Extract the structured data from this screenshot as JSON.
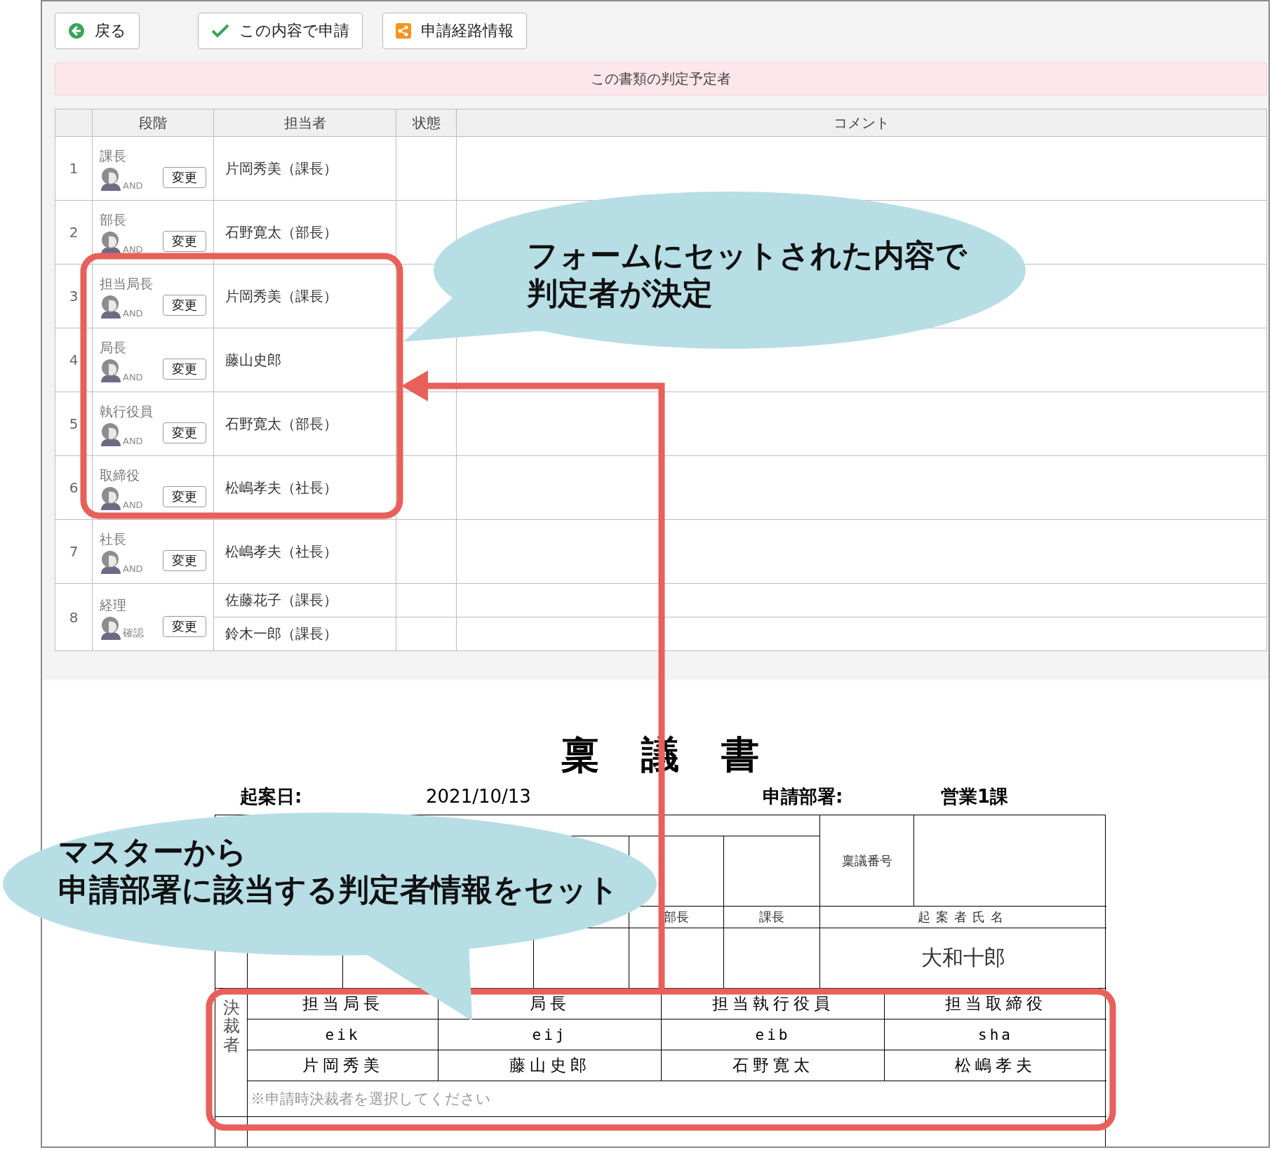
{
  "toolbar": {
    "buttons": [
      {
        "kind": "back",
        "label": "戻る"
      },
      {
        "kind": "check",
        "label": "この内容で申請"
      },
      {
        "kind": "route",
        "label": "申請経路情報"
      }
    ]
  },
  "banner": "この書類の判定予定者",
  "approvers": {
    "columns": [
      "段階",
      "担当者",
      "状態",
      "コメント"
    ],
    "rows": [
      {
        "number": "1",
        "stage": "課長",
        "mode": "AND",
        "action": "変更",
        "assignees": [
          "片岡秀美（課長）"
        ]
      },
      {
        "number": "2",
        "stage": "部長",
        "mode": "AND",
        "action": "変更",
        "assignees": [
          "石野寛太（部長）"
        ]
      },
      {
        "number": "3",
        "stage": "担当局長",
        "mode": "AND",
        "action": "変更",
        "assignees": [
          "片岡秀美（課長）"
        ]
      },
      {
        "number": "4",
        "stage": "局長",
        "mode": "AND",
        "action": "変更",
        "assignees": [
          "藤山史郎"
        ]
      },
      {
        "number": "5",
        "stage": "執行役員",
        "mode": "AND",
        "action": "変更",
        "assignees": [
          "石野寛太（部長）"
        ]
      },
      {
        "number": "6",
        "stage": "取締役",
        "mode": "AND",
        "action": "変更",
        "assignees": [
          "松嶋孝夫（社長）"
        ]
      },
      {
        "number": "7",
        "stage": "社長",
        "mode": "AND",
        "action": "変更",
        "assignees": [
          "松嶋孝夫（社長）"
        ]
      },
      {
        "number": "8",
        "stage": "経理",
        "mode": "確認",
        "action": "変更",
        "assignees": [
          "佐藤花子（課長）",
          "鈴木一郎（課長）"
        ]
      }
    ]
  },
  "document": {
    "title": "稟議書",
    "fields": [
      {
        "label": "起案日:",
        "value": "2021/10/13"
      },
      {
        "label": "申請部署:",
        "value": "営業1課"
      }
    ],
    "stamp_headers": [
      "部長",
      "課長"
    ],
    "number_label": "稟議番号",
    "drafter_label": "起案者氏名",
    "drafter": "大和十郎",
    "approvers_label": "決裁者",
    "approvers": [
      {
        "role": "担当局長",
        "code": "eik",
        "name": "片岡秀美"
      },
      {
        "role": "局長",
        "code": "eij",
        "name": "藤山史郎"
      },
      {
        "role": "担当執行役員",
        "code": "eib",
        "name": "石野寛太"
      },
      {
        "role": "担当取締役",
        "code": "sha",
        "name": "松嶋孝夫"
      }
    ],
    "note": "※申請時決裁者を選択してください"
  },
  "callouts": [
    {
      "lines": [
        "フォームにセットされた内容で",
        "判定者が決定"
      ]
    },
    {
      "lines": [
        "マスターから",
        "申請部署に該当する判定者情報をセット"
      ]
    }
  ]
}
